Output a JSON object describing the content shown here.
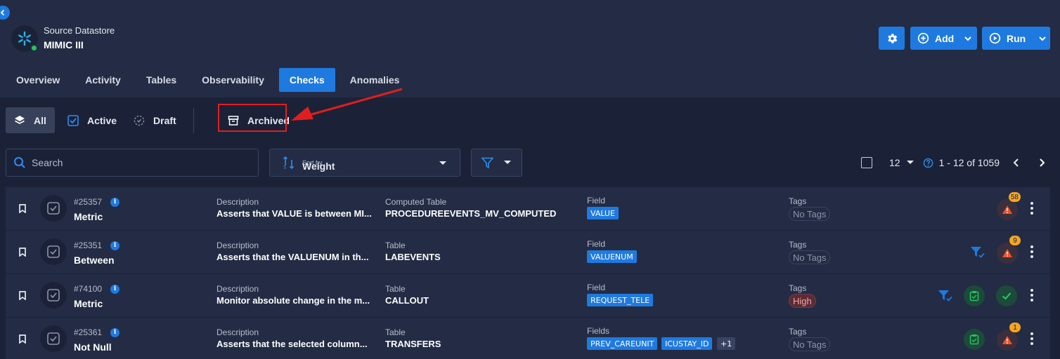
{
  "header": {
    "datastore_label": "Source Datastore",
    "datastore_name": "MIMIC III",
    "buttons": {
      "add": "Add",
      "run": "Run"
    }
  },
  "tabs": [
    "Overview",
    "Activity",
    "Tables",
    "Observability",
    "Checks",
    "Anomalies"
  ],
  "active_tab": "Checks",
  "filters": {
    "all": "All",
    "active": "Active",
    "draft": "Draft",
    "archived": "Archived"
  },
  "search": {
    "placeholder": "Search"
  },
  "sort": {
    "label": "Sort by",
    "value": "Weight"
  },
  "pager": {
    "per_page": "12",
    "range": "1 - 12 of 1059"
  },
  "checks": [
    {
      "id": "#25357",
      "type": "Metric",
      "desc_label": "Description",
      "desc": "Asserts that VALUE is between MI...",
      "table_label": "Computed Table",
      "table": "PROCEDUREEVENTS_MV_COMPUTED",
      "field_label": "Field",
      "fields": [
        "VALUE"
      ],
      "more": "",
      "tags_label": "Tags",
      "tag": "No Tags",
      "anomalies": "58"
    },
    {
      "id": "#25351",
      "type": "Between",
      "desc_label": "Description",
      "desc": "Asserts that the VALUENUM in th...",
      "table_label": "Table",
      "table": "LABEVENTS",
      "field_label": "Field",
      "fields": [
        "VALUENUM"
      ],
      "more": "",
      "tags_label": "Tags",
      "tag": "No Tags",
      "anomalies": "9"
    },
    {
      "id": "#74100",
      "type": "Metric",
      "desc_label": "Description",
      "desc": "Monitor absolute change in the m...",
      "table_label": "Table",
      "table": "CALLOUT",
      "field_label": "Field",
      "fields": [
        "REQUEST_TELE"
      ],
      "more": "",
      "tags_label": "Tags",
      "tag": "High",
      "anomalies": ""
    },
    {
      "id": "#25361",
      "type": "Not Null",
      "desc_label": "Description",
      "desc": "Asserts that the selected column...",
      "table_label": "Table",
      "table": "TRANSFERS",
      "field_label": "Fields",
      "fields": [
        "PREV_CAREUNIT",
        "ICUSTAY_ID"
      ],
      "more": "+1",
      "tags_label": "Tags",
      "tag": "No Tags",
      "anomalies": "1"
    }
  ],
  "colors": {
    "accent": "#1f7ae0",
    "background": "#1b2238",
    "panel": "#232c44",
    "highlight": "#e01e1e",
    "warning": "#f5a623"
  }
}
